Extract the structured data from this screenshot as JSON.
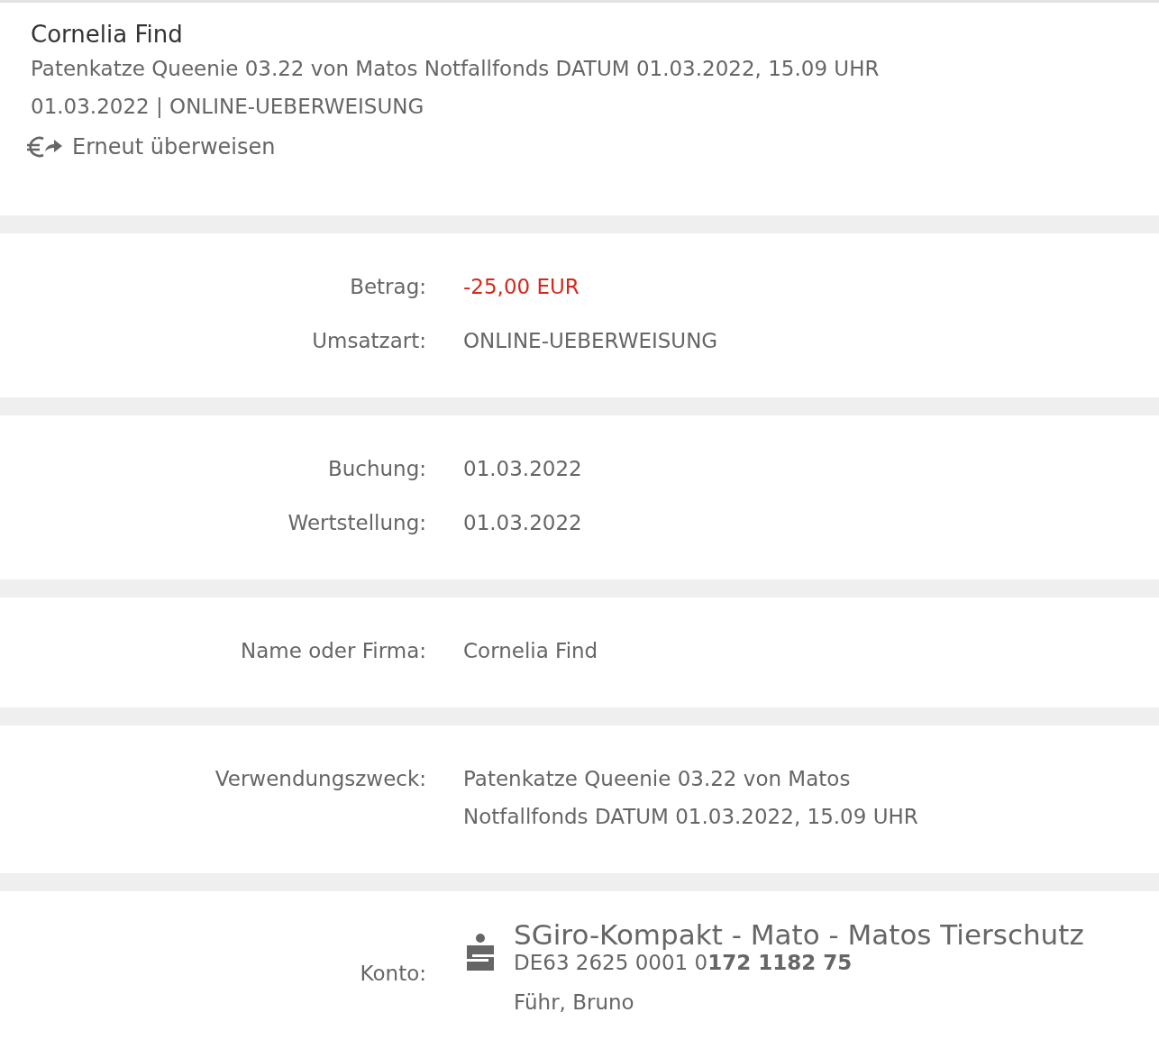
{
  "header": {
    "title": "Cornelia Find",
    "subtitle": "Patenkatze Queenie 03.22 von Matos Notfallfonds DATUM 01.03.2022, 15.09 UHR",
    "meta": "01.03.2022 | ONLINE-UEBERWEISUNG",
    "action": "Erneut überweisen"
  },
  "sections": [
    {
      "rows": [
        {
          "kind": "amount",
          "label": "Betrag:",
          "value": "-25,00 EUR"
        },
        {
          "kind": "text",
          "label": "Umsatzart:",
          "value": "ONLINE-UEBERWEISUNG"
        }
      ]
    },
    {
      "rows": [
        {
          "kind": "text",
          "label": "Buchung:",
          "value": "01.03.2022"
        },
        {
          "kind": "text",
          "label": "Wertstellung:",
          "value": "01.03.2022"
        }
      ]
    },
    {
      "rows": [
        {
          "kind": "text",
          "label": "Name oder Firma:",
          "value": "Cornelia Find"
        }
      ]
    },
    {
      "rows": [
        {
          "kind": "text",
          "label": "Verwendungszweck:",
          "value": "Patenkatze Queenie 03.22 von Matos Notfallfonds DATUM 01.03.2022, 15.09 UHR"
        }
      ]
    },
    {
      "rows": [
        {
          "kind": "account",
          "label": "Konto:",
          "account_name": "SGiro-Kompakt - Mato - Matos Tierschutz",
          "iban": "DE63 2625 0001 0**172 1182 75**",
          "holder": "Führ, Bruno"
        }
      ]
    }
  ]
}
